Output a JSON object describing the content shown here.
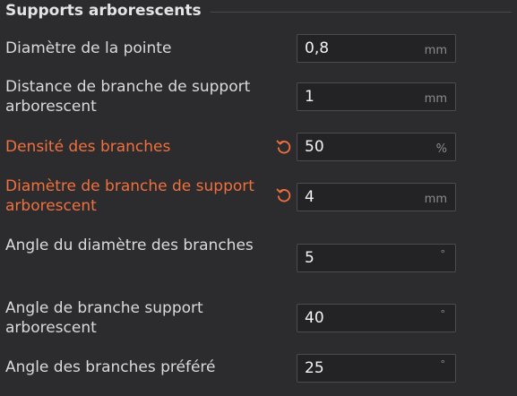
{
  "section": {
    "title": "Supports arborescents"
  },
  "colors": {
    "modified_label": "#f0703e",
    "background": "#2c2c2f",
    "field_border": "#4b4b50"
  },
  "rows": [
    {
      "label": "Diamètre de la pointe",
      "value": "0,8",
      "unit": "mm",
      "modified": false
    },
    {
      "label": "Distance de branche de support arborescent",
      "value": "1",
      "unit": "mm",
      "modified": false
    },
    {
      "label": "Densité des branches",
      "value": "50",
      "unit": "%",
      "modified": true,
      "reset_icon": "undo-icon"
    },
    {
      "label": "Diamètre de branche de support arborescent",
      "value": "4",
      "unit": "mm",
      "modified": true,
      "reset_icon": "undo-icon"
    },
    {
      "label": "Angle du diamètre des branches",
      "value": "5",
      "unit": "°",
      "modified": false
    },
    {
      "label": "Angle de branche support arborescent",
      "value": "40",
      "unit": "°",
      "modified": false
    },
    {
      "label": "Angle des branches préféré",
      "value": "25",
      "unit": "°",
      "modified": false
    }
  ]
}
